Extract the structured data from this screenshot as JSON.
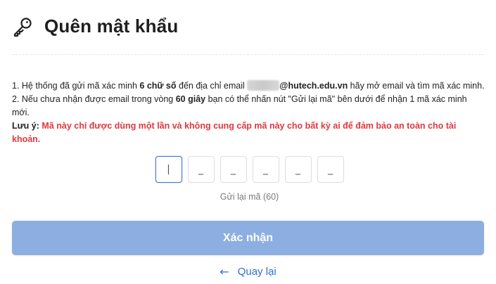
{
  "header": {
    "icon": "key-icon",
    "title": "Quên mật khẩu"
  },
  "info": {
    "line1_prefix": "1. Hệ thống đã gửi mã xác minh ",
    "line1_bold": "6 chữ số",
    "line1_mid": " đến địa chỉ email ",
    "line1_email_domain": "@hutech.edu.vn",
    "line1_suffix": " hãy mở email và tìm mã xác minh.",
    "line2_prefix": "2. Nếu chưa nhận được email trong vòng ",
    "line2_bold": "60 giây",
    "line2_suffix": " bạn có thể nhấn nút \"Gửi lại mã\" bên dưới để nhận 1 mã xác minh mới.",
    "note_label": "Lưu ý:",
    "note_text": "Mã này chỉ được dùng một lần và không cung cấp mã này cho bất kỳ ai để đảm bảo an toàn cho tài khoản."
  },
  "otp": {
    "digits": [
      "",
      "",
      "",
      "",
      "",
      ""
    ],
    "cursor_glyph": "|",
    "placeholder": "_"
  },
  "resend": {
    "label": "Gửi lại mã (60)"
  },
  "confirm": {
    "label": "Xác nhận"
  },
  "back": {
    "icon": "arrow-left-icon",
    "arrow": "←",
    "label": "Quay lại"
  },
  "colors": {
    "accent": "#2f6fd8",
    "button_disabled": "#8daee0",
    "warning": "#e0383e"
  }
}
